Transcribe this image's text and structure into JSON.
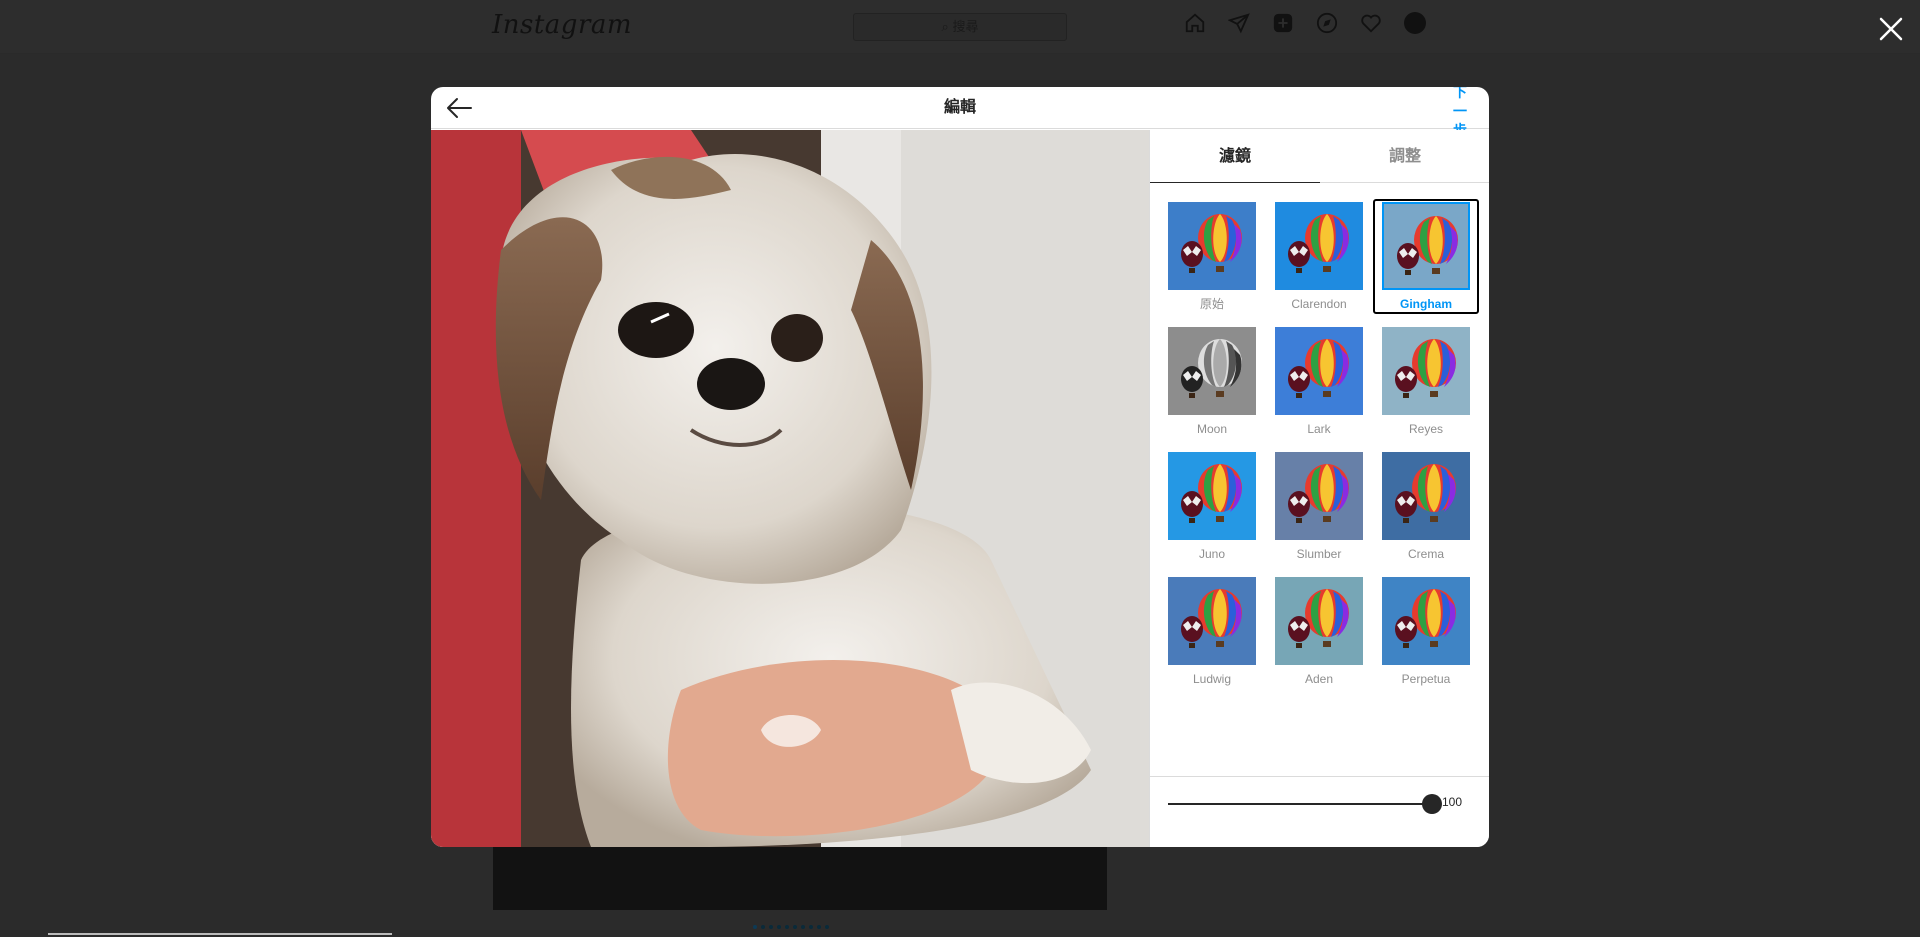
{
  "background": {
    "logo": "Instagram",
    "search_placeholder": "⌕ 搜尋",
    "nav_icons": [
      "home-icon",
      "direct-icon",
      "new-post-icon",
      "explore-icon",
      "heart-icon",
      "avatar"
    ]
  },
  "modal": {
    "title": "編輯",
    "next_label": "下一步",
    "tabs": [
      {
        "label": "濾鏡",
        "active": true
      },
      {
        "label": "調整",
        "active": false
      }
    ],
    "filters": [
      {
        "name": "原始",
        "tint": "#3d7ec9",
        "selected": false
      },
      {
        "name": "Clarendon",
        "tint": "#1f8be0",
        "selected": false
      },
      {
        "name": "Gingham",
        "tint": "#7aa7c8",
        "selected": true
      },
      {
        "name": "Moon",
        "tint": "#8d8d8d",
        "selected": false
      },
      {
        "name": "Lark",
        "tint": "#3d7ed8",
        "selected": false
      },
      {
        "name": "Reyes",
        "tint": "#8fb3c6",
        "selected": false
      },
      {
        "name": "Juno",
        "tint": "#2598e4",
        "selected": false
      },
      {
        "name": "Slumber",
        "tint": "#6780a8",
        "selected": false
      },
      {
        "name": "Crema",
        "tint": "#3e6da3",
        "selected": false
      },
      {
        "name": "Ludwig",
        "tint": "#4a7bba",
        "selected": false
      },
      {
        "name": "Aden",
        "tint": "#77a6b6",
        "selected": false
      },
      {
        "name": "Perpetua",
        "tint": "#3f84c5",
        "selected": false
      }
    ],
    "intensity": {
      "value": 100,
      "value_label": "100",
      "max": 100
    }
  },
  "colors": {
    "accent": "#0095f6",
    "text": "#262626",
    "muted": "#8e8e8e"
  }
}
